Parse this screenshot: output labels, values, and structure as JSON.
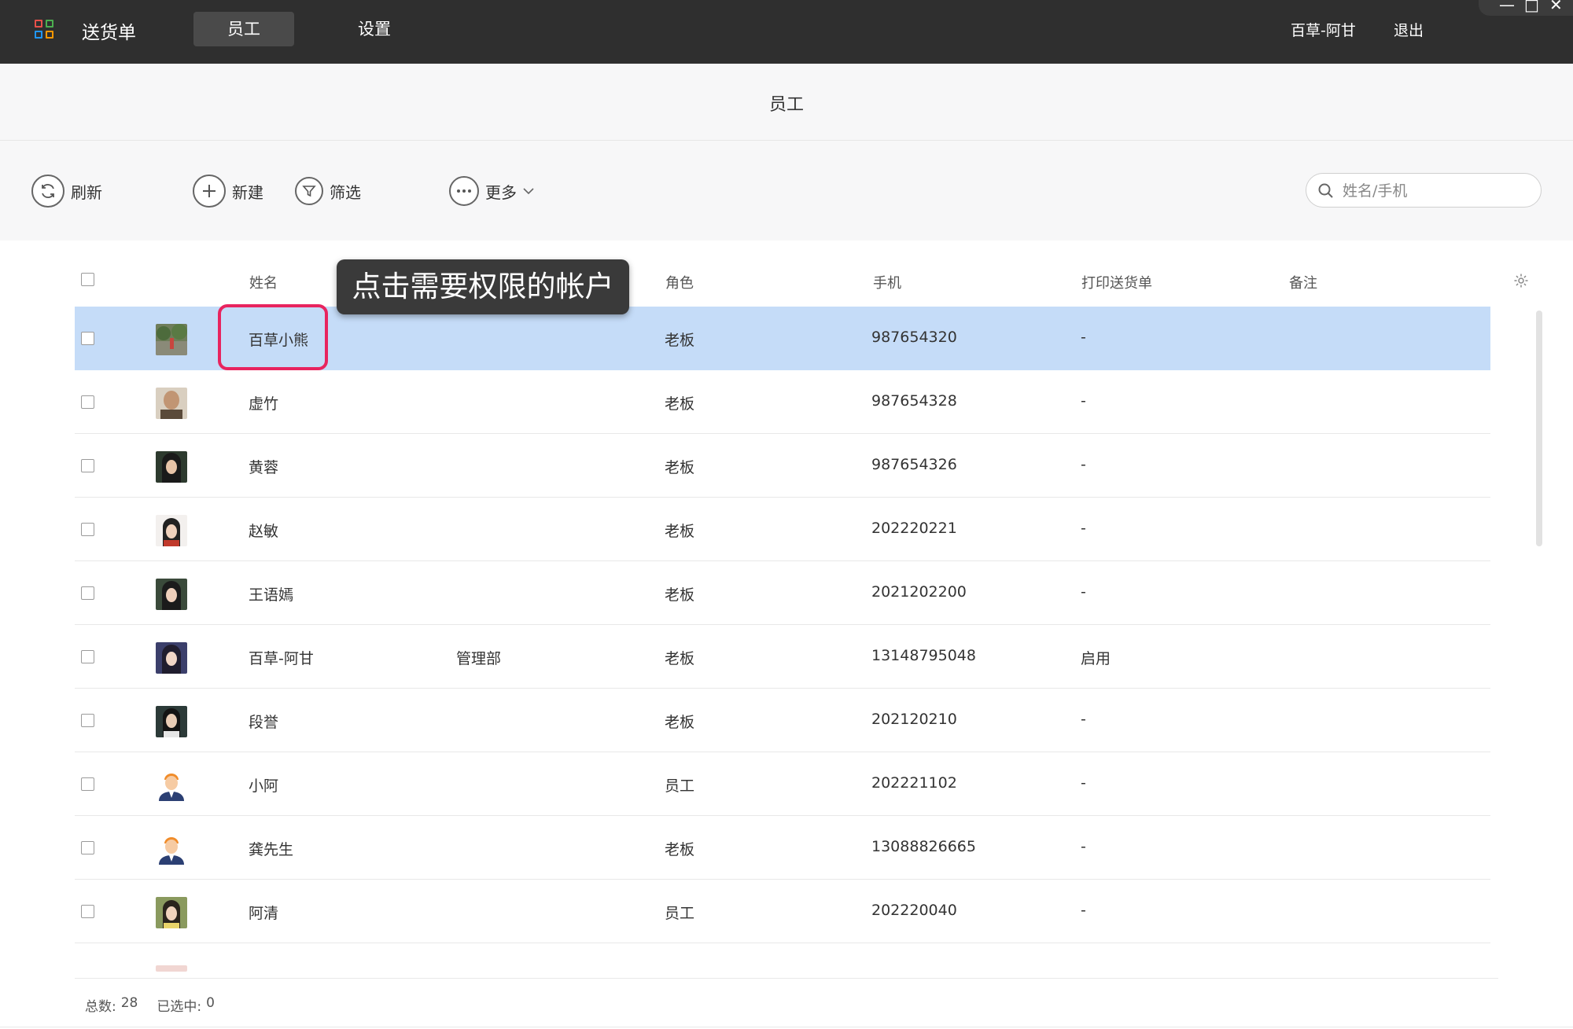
{
  "app": {
    "title": "送货单",
    "nav": [
      {
        "label": "员工",
        "active": true
      },
      {
        "label": "设置",
        "active": false
      }
    ],
    "user": "百草-阿甘",
    "logout": "退出",
    "window_controls": {
      "minimize": "—",
      "maximize": "□",
      "close": "✕"
    }
  },
  "page": {
    "title": "员工"
  },
  "toolbar": {
    "refresh": "刷新",
    "new": "新建",
    "filter": "筛选",
    "more": "更多",
    "search_placeholder": "姓名/手机"
  },
  "table": {
    "columns": {
      "name": "姓名",
      "role": "角色",
      "phone": "手机",
      "print": "打印送货单",
      "note": "备注"
    },
    "rows": [
      {
        "name": "百草小熊",
        "dept": "",
        "role": "老板",
        "phone": "987654320",
        "print": "-",
        "note": "",
        "selected": true,
        "avatar": "forest-photo"
      },
      {
        "name": "虚竹",
        "dept": "",
        "role": "老板",
        "phone": "987654328",
        "print": "-",
        "note": "",
        "selected": false,
        "avatar": "monk-photo"
      },
      {
        "name": "黄蓉",
        "dept": "",
        "role": "老板",
        "phone": "987654326",
        "print": "-",
        "note": "",
        "selected": false,
        "avatar": "woman-photo"
      },
      {
        "name": "赵敏",
        "dept": "",
        "role": "老板",
        "phone": "202220221",
        "print": "-",
        "note": "",
        "selected": false,
        "avatar": "woman-photo"
      },
      {
        "name": "王语嫣",
        "dept": "",
        "role": "老板",
        "phone": "2021202200",
        "print": "-",
        "note": "",
        "selected": false,
        "avatar": "woman-photo"
      },
      {
        "name": "百草-阿甘",
        "dept": "管理部",
        "role": "老板",
        "phone": "13148795048",
        "print": "启用",
        "note": "",
        "selected": false,
        "avatar": "woman-photo"
      },
      {
        "name": "段誉",
        "dept": "",
        "role": "老板",
        "phone": "202120210",
        "print": "-",
        "note": "",
        "selected": false,
        "avatar": "man-photo"
      },
      {
        "name": "小阿",
        "dept": "",
        "role": "员工",
        "phone": "202221102",
        "print": "-",
        "note": "",
        "selected": false,
        "avatar": "cartoon-man"
      },
      {
        "name": "龚先生",
        "dept": "",
        "role": "老板",
        "phone": "13088826665",
        "print": "-",
        "note": "",
        "selected": false,
        "avatar": "cartoon-man"
      },
      {
        "name": "阿清",
        "dept": "",
        "role": "员工",
        "phone": "202220040",
        "print": "-",
        "note": "",
        "selected": false,
        "avatar": "woman-photo"
      }
    ]
  },
  "callout": {
    "text": "点击需要权限的帐户"
  },
  "footer": {
    "total_label": "总数:",
    "total": "28",
    "selected_label": "已选中:",
    "selected": "0"
  },
  "colors": {
    "topbar": "#2f2f2f",
    "selected_row": "#c5dcf8",
    "highlight": "#e8245f"
  }
}
